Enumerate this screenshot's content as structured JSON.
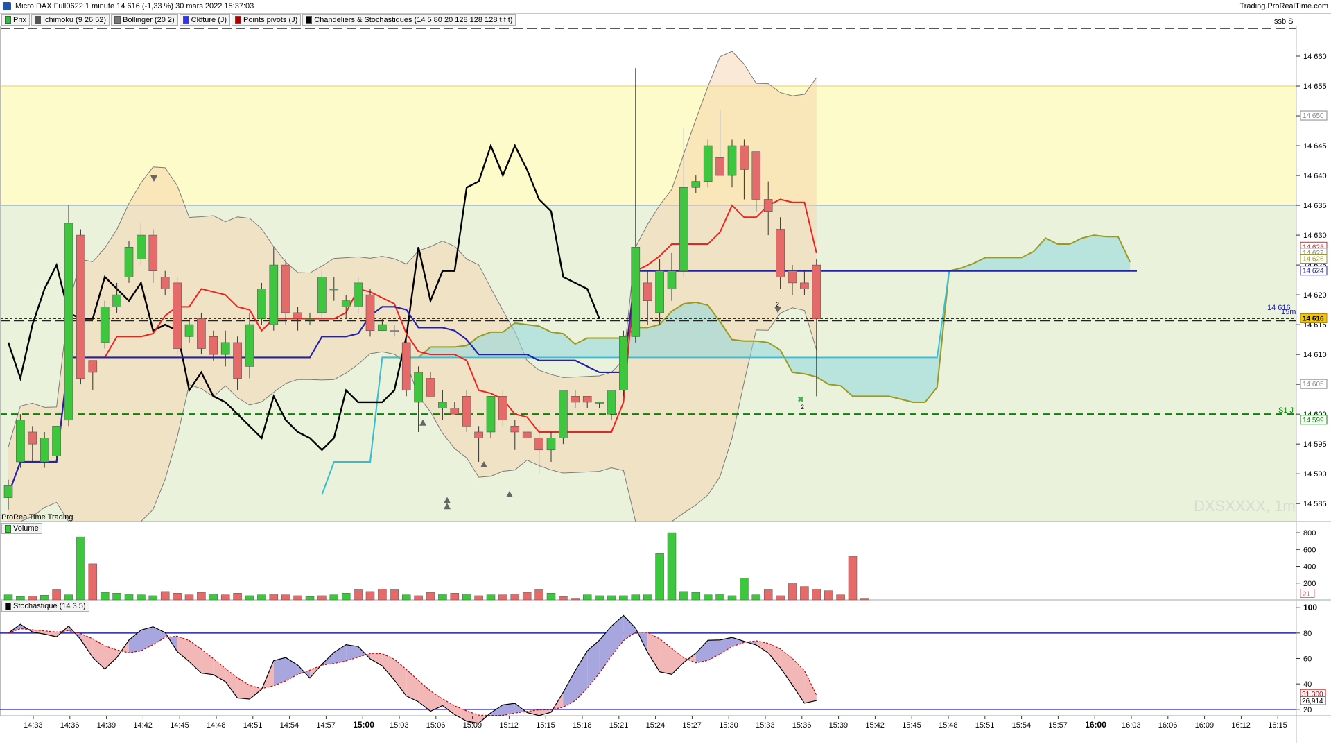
{
  "window": {
    "title": "Micro DAX Full0622 1 minute 14 616 (-1,33 %) 30 mars 2022 15:37:03",
    "brand": "Trading.ProRealTime.com"
  },
  "legend": [
    {
      "label": "Prix",
      "color": "#3cb44b"
    },
    {
      "label": "Ichimoku (9 26 52)",
      "color": "#555555"
    },
    {
      "label": "Bollinger (20 2)",
      "color": "#777777"
    },
    {
      "label": "Clôture (J)",
      "color": "#3030ff"
    },
    {
      "label": "Points pivots (J)",
      "color": "#aa0000"
    },
    {
      "label": "Chandeliers & Stochastiques (14 5 80 20 128 128 128 t f t)",
      "color": "#000000"
    }
  ],
  "labels": {
    "ssb": "ssb S",
    "software": "ProRealTime Trading",
    "watermark": "DXSXXXX, 1m",
    "volume_panel": "Volume",
    "stoch_panel": "Stochastique (14 3 5)",
    "pivot_label": "S1 J",
    "close_label": "14 616",
    "close_suffix": "15m"
  },
  "colors": {
    "up": "#3ec63e",
    "down": "#e56a6a",
    "tenkan": "#ee2222",
    "kijun": "#2323aa",
    "chikou": "#000000",
    "ssa": "#9a9a20",
    "ssb_line": "#29c3e8",
    "bollinger": "#7a7a7a",
    "pivot": "#008800",
    "stoch_k": "#000000",
    "stoch_d": "#cc0000",
    "stoch_levels": "#2323aa",
    "zone_high": "#fdfbc9",
    "zone_mid": "#ebf2dc"
  },
  "chart_data": [
    {
      "type": "candlestick",
      "title": "Micro DAX Full0622 1 minute",
      "ylim": [
        14582,
        14665
      ],
      "y_ticks": [
        14585,
        14590,
        14595,
        14600,
        14605,
        14610,
        14615,
        14620,
        14625,
        14630,
        14635,
        14640,
        14645,
        14650,
        14655,
        14660
      ],
      "x_ticks": [
        "14:33",
        "14:36",
        "14:39",
        "14:42",
        "14:45",
        "14:48",
        "14:51",
        "14:54",
        "14:57",
        "15:00",
        "15:03",
        "15:06",
        "15:09",
        "15:12",
        "15:15",
        "15:18",
        "15:21",
        "15:24",
        "15:27",
        "15:30",
        "15:33",
        "15:36",
        "15:39",
        "15:42",
        "15:45",
        "15:48",
        "15:51",
        "15:54",
        "15:57",
        "16:00",
        "16:03",
        "16:06",
        "16:09",
        "16:12",
        "16:15"
      ],
      "candles": [
        {
          "o": 14586,
          "h": 14589,
          "l": 14584,
          "c": 14588
        },
        {
          "o": 14592,
          "h": 14600,
          "l": 14591,
          "c": 14599
        },
        {
          "o": 14597,
          "h": 14598,
          "l": 14592,
          "c": 14595
        },
        {
          "o": 14592,
          "h": 14597,
          "l": 14591,
          "c": 14596
        },
        {
          "o": 14593,
          "h": 14598,
          "l": 14592,
          "c": 14598
        },
        {
          "o": 14599,
          "h": 14635,
          "l": 14598,
          "c": 14632
        },
        {
          "o": 14630,
          "h": 14631,
          "l": 14605,
          "c": 14606
        },
        {
          "o": 14609,
          "h": 14609,
          "l": 14604,
          "c": 14607
        },
        {
          "o": 14612,
          "h": 14619,
          "l": 14611,
          "c": 14618
        },
        {
          "o": 14618,
          "h": 14622,
          "l": 14617,
          "c": 14620
        },
        {
          "o": 14623,
          "h": 14629,
          "l": 14622,
          "c": 14628
        },
        {
          "o": 14626,
          "h": 14632,
          "l": 14625,
          "c": 14630
        },
        {
          "o": 14630,
          "h": 14631,
          "l": 14622,
          "c": 14624
        },
        {
          "o": 14623,
          "h": 14624,
          "l": 14620,
          "c": 14621
        },
        {
          "o": 14622,
          "h": 14623,
          "l": 14610,
          "c": 14611
        },
        {
          "o": 14613,
          "h": 14616,
          "l": 14612,
          "c": 14615
        },
        {
          "o": 14616,
          "h": 14617,
          "l": 14610,
          "c": 14611
        },
        {
          "o": 14613,
          "h": 14614,
          "l": 14609,
          "c": 14610
        },
        {
          "o": 14610,
          "h": 14614,
          "l": 14608,
          "c": 14612
        },
        {
          "o": 14612,
          "h": 14613,
          "l": 14604,
          "c": 14606
        },
        {
          "o": 14608,
          "h": 14617,
          "l": 14606,
          "c": 14615
        },
        {
          "o": 14616,
          "h": 14622,
          "l": 14615,
          "c": 14621
        },
        {
          "o": 14615,
          "h": 14628,
          "l": 14614,
          "c": 14625
        },
        {
          "o": 14625,
          "h": 14626,
          "l": 14615,
          "c": 14617
        },
        {
          "o": 14617,
          "h": 14618,
          "l": 14614,
          "c": 14616
        },
        {
          "o": 14616,
          "h": 14617,
          "l": 14615,
          "c": 14616
        },
        {
          "o": 14617,
          "h": 14624,
          "l": 14616,
          "c": 14623
        },
        {
          "o": 14621,
          "h": 14623,
          "l": 14619,
          "c": 14621
        },
        {
          "o": 14618,
          "h": 14620,
          "l": 14616,
          "c": 14619
        },
        {
          "o": 14618,
          "h": 14623,
          "l": 14617,
          "c": 14622
        },
        {
          "o": 14620,
          "h": 14621,
          "l": 14613,
          "c": 14614
        },
        {
          "o": 14614,
          "h": 14616,
          "l": 14614,
          "c": 14615
        },
        {
          "o": 14614,
          "h": 14615,
          "l": 14613,
          "c": 14614
        },
        {
          "o": 14612,
          "h": 14613,
          "l": 14603,
          "c": 14604
        },
        {
          "o": 14602,
          "h": 14608,
          "l": 14597,
          "c": 14607
        },
        {
          "o": 14606,
          "h": 14607,
          "l": 14603,
          "c": 14603
        },
        {
          "o": 14601,
          "h": 14604,
          "l": 14599,
          "c": 14602
        },
        {
          "o": 14601,
          "h": 14602,
          "l": 14600,
          "c": 14600
        },
        {
          "o": 14603,
          "h": 14604,
          "l": 14597,
          "c": 14598
        },
        {
          "o": 14597,
          "h": 14598,
          "l": 14592,
          "c": 14596
        },
        {
          "o": 14597,
          "h": 14603,
          "l": 14596,
          "c": 14603
        },
        {
          "o": 14603,
          "h": 14604,
          "l": 14598,
          "c": 14599
        },
        {
          "o": 14598,
          "h": 14599,
          "l": 14594,
          "c": 14597
        },
        {
          "o": 14597,
          "h": 14597,
          "l": 14596,
          "c": 14596
        },
        {
          "o": 14596,
          "h": 14598,
          "l": 14590,
          "c": 14594
        },
        {
          "o": 14594,
          "h": 14597,
          "l": 14592,
          "c": 14596
        },
        {
          "o": 14596,
          "h": 14604,
          "l": 14595,
          "c": 14604
        },
        {
          "o": 14603,
          "h": 14604,
          "l": 14601,
          "c": 14602
        },
        {
          "o": 14603,
          "h": 14603,
          "l": 14601,
          "c": 14602
        },
        {
          "o": 14602,
          "h": 14602,
          "l": 14601,
          "c": 14602
        },
        {
          "o": 14600,
          "h": 14604,
          "l": 14599,
          "c": 14604
        },
        {
          "o": 14604,
          "h": 14614,
          "l": 14603,
          "c": 14613
        },
        {
          "o": 14613,
          "h": 14658,
          "l": 14612,
          "c": 14628
        },
        {
          "o": 14622,
          "h": 14624,
          "l": 14615,
          "c": 14619
        },
        {
          "o": 14617,
          "h": 14626,
          "l": 14615,
          "c": 14624
        },
        {
          "o": 14621,
          "h": 14627,
          "l": 14619,
          "c": 14624
        },
        {
          "o": 14624,
          "h": 14648,
          "l": 14623,
          "c": 14638
        },
        {
          "o": 14638,
          "h": 14640,
          "l": 14637,
          "c": 14639
        },
        {
          "o": 14639,
          "h": 14646,
          "l": 14638,
          "c": 14645
        },
        {
          "o": 14643,
          "h": 14651,
          "l": 14642,
          "c": 14640
        },
        {
          "o": 14640,
          "h": 14646,
          "l": 14638,
          "c": 14645
        },
        {
          "o": 14645,
          "h": 14646,
          "l": 14636,
          "c": 14641
        },
        {
          "o": 14644,
          "h": 14644,
          "l": 14634,
          "c": 14636
        },
        {
          "o": 14636,
          "h": 14639,
          "l": 14630,
          "c": 14634
        },
        {
          "o": 14631,
          "h": 14633,
          "l": 14621,
          "c": 14623
        },
        {
          "o": 14624,
          "h": 14625,
          "l": 14620,
          "c": 14622
        },
        {
          "o": 14622,
          "h": 14624,
          "l": 14620,
          "c": 14621
        },
        {
          "o": 14625,
          "h": 14626,
          "l": 14603,
          "c": 14616
        }
      ],
      "price_axis_labels": [
        14650,
        14628,
        14627,
        14626,
        14624,
        14616,
        14605,
        14599
      ],
      "last_price": 14616,
      "pivot_s1": 14600,
      "zone_boundaries": [
        14655,
        14635,
        14582
      ]
    },
    {
      "type": "bar",
      "title": "Volume",
      "ylim": [
        0,
        850
      ],
      "y_ticks": [
        200,
        400,
        600,
        800
      ],
      "last_value": 21,
      "values": [
        60,
        40,
        45,
        55,
        120,
        60,
        750,
        430,
        90,
        80,
        70,
        60,
        50,
        100,
        80,
        60,
        90,
        70,
        60,
        80,
        50,
        60,
        70,
        60,
        50,
        40,
        50,
        60,
        80,
        120,
        100,
        130,
        120,
        60,
        50,
        90,
        70,
        80,
        70,
        50,
        60,
        60,
        70,
        90,
        120,
        80,
        40,
        20,
        60,
        50,
        50,
        50,
        60,
        60,
        550,
        800,
        100,
        90,
        60,
        70,
        50,
        260,
        60,
        120,
        50,
        200,
        160,
        130,
        110,
        60,
        520,
        20
      ],
      "colors": [
        "up",
        "up",
        "down",
        "up",
        "down",
        "up",
        "up",
        "down",
        "up",
        "up",
        "up",
        "up",
        "up",
        "down",
        "down",
        "down",
        "down",
        "up",
        "down",
        "down",
        "up",
        "up",
        "down",
        "down",
        "down",
        "up",
        "down",
        "up",
        "up",
        "down",
        "down",
        "down",
        "down",
        "up",
        "down",
        "down",
        "up",
        "down",
        "up",
        "down",
        "up",
        "down",
        "down",
        "down",
        "down",
        "up",
        "down",
        "down",
        "up",
        "up",
        "up",
        "up",
        "up",
        "up",
        "up",
        "up",
        "up",
        "up",
        "up",
        "up",
        "up",
        "up",
        "up",
        "down",
        "down",
        "down",
        "down",
        "down",
        "down",
        "down",
        "down",
        "down"
      ]
    },
    {
      "type": "line",
      "title": "Stochastique (14 3 5)",
      "ylim": [
        15,
        105
      ],
      "y_ticks": [
        20,
        40,
        60,
        80,
        100
      ],
      "levels": [
        80,
        20
      ],
      "series": [
        {
          "name": "K",
          "last_value": 26.914
        },
        {
          "name": "D",
          "last_value": 31.3
        }
      ]
    }
  ],
  "markers": {
    "arrow_down_positions": [
      14640,
      14618
    ],
    "arrow_up_positions": [
      14599,
      14592,
      14585,
      14587,
      14586
    ],
    "marker_text": "2"
  }
}
